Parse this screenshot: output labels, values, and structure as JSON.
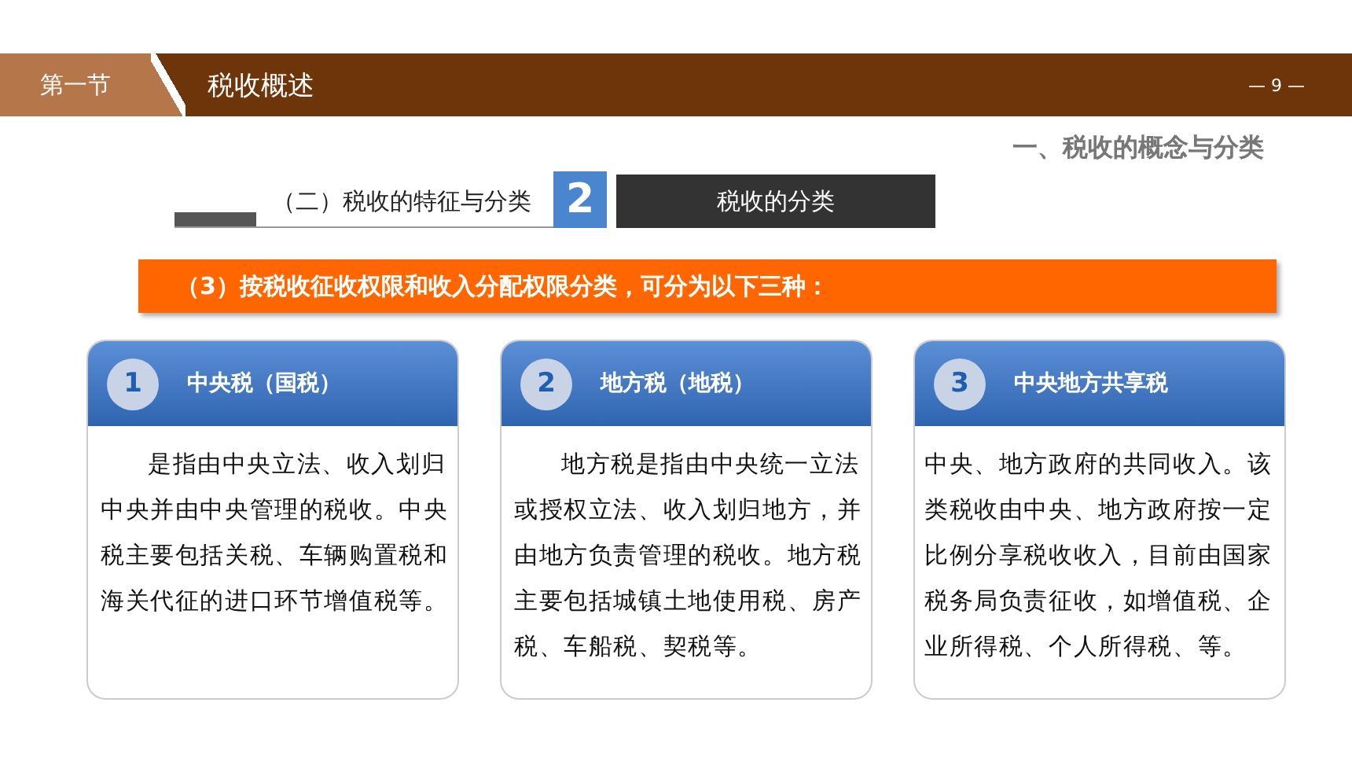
{
  "header": {
    "section": "第一节",
    "title": "税收概述",
    "page": "— 9 —"
  },
  "chapter_title": "一、税收的概念与分类",
  "subheading": {
    "label": "（二）税收的特征与分类",
    "number": "2",
    "title": "税收的分类"
  },
  "banner": "（3）按税收征收权限和收入分配权限分类，可分为以下三种：",
  "cards": [
    {
      "number": "1",
      "title": "中央税（国税）",
      "indent": true,
      "body": "是指由中央立法、收入划归中央并由中央管理的税收。中央税主要包括关税、车辆购置税和海关代征的进口环节增值税等。"
    },
    {
      "number": "2",
      "title": "地方税（地税）",
      "indent": true,
      "body": "地方税是指由中央统一立法或授权立法、收入划归地方，并由地方负责管理的税收。地方税主要包括城镇土地使用税、房产税、车船税、契税等。"
    },
    {
      "number": "3",
      "title": "中央地方共享税",
      "indent": false,
      "body": "中央、地方政府的共同收入。该类税收由中央、地方政府按一定比例分享税收收入，目前由国家税务局负责征收，如增值税、企业所得税、个人所得税、等。"
    }
  ]
}
